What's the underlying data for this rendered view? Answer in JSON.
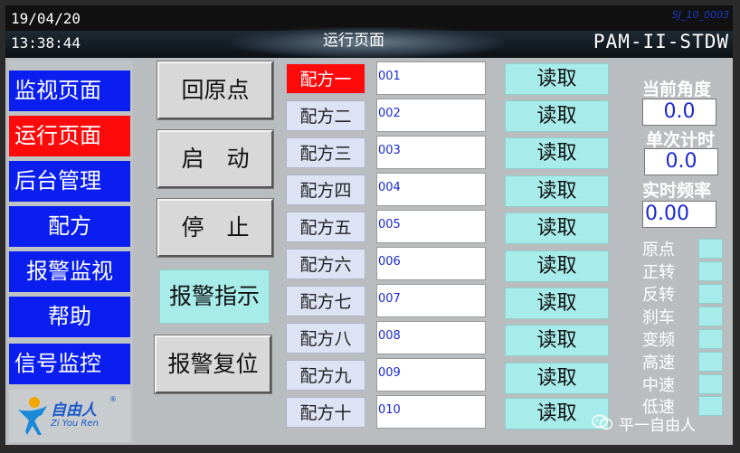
{
  "header": {
    "date": "19/04/20",
    "time": "13:38:44",
    "title": "运行页面",
    "model": "PAM-II-STDW",
    "code": "SJ_10_0003"
  },
  "nav": {
    "items": [
      {
        "label": "监视页面"
      },
      {
        "label": "运行页面"
      },
      {
        "label": "后台管理"
      },
      {
        "label": "配方"
      },
      {
        "label": "报警监视"
      },
      {
        "label": "帮助"
      },
      {
        "label": "信号监控"
      }
    ]
  },
  "logo": {
    "text": "自由人",
    "sub": "Zi You Ren",
    "mark": "®"
  },
  "controls": {
    "home": "回原点",
    "start": "启　动",
    "stop": "停　止",
    "alarm_indicator": "报警指示",
    "alarm_reset": "报警复位"
  },
  "recipes": {
    "labels": [
      "配方一",
      "配方二",
      "配方三",
      "配方四",
      "配方五",
      "配方六",
      "配方七",
      "配方八",
      "配方九",
      "配方十"
    ],
    "values": [
      "001",
      "002",
      "003",
      "004",
      "005",
      "006",
      "007",
      "008",
      "009",
      "010"
    ],
    "read_label": "读取"
  },
  "status": {
    "angle_label": "当前角度",
    "angle_value": "0.0",
    "timer_label": "单次计时",
    "timer_value": "0.0",
    "freq_label": "实时频率",
    "freq_value": "0.00",
    "indicators": [
      "原点",
      "正转",
      "反转",
      "刹车",
      "变频",
      "高速",
      "中速",
      "低速"
    ]
  },
  "watermark": "平一自由人",
  "colors": {
    "nav_blue": "#0a1ef0",
    "active_red": "#ff0a0a",
    "cyan": "#a7ecea"
  }
}
